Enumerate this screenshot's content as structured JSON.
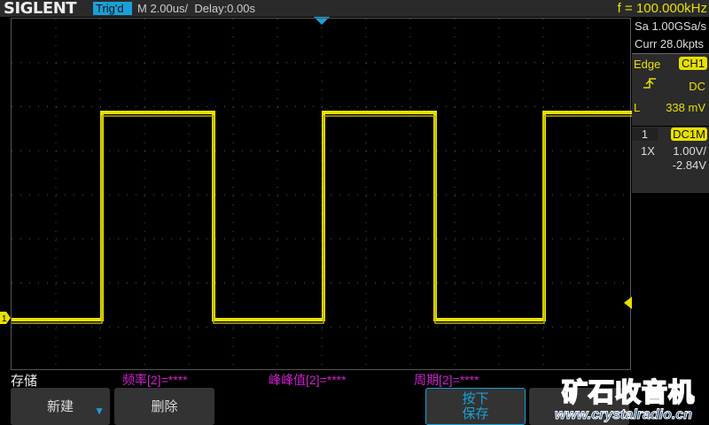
{
  "header": {
    "brand": "SIGLENT",
    "trigger_status": "Trig'd",
    "timebase": "M 2.00us/",
    "delay": "Delay:0.00s",
    "frequency": "f = 100.000kHz"
  },
  "acquisition": {
    "sample_rate": "Sa 1.00GSa/s",
    "memory": "Curr 28.0kpts"
  },
  "trigger": {
    "type": "Edge",
    "source": "CH1",
    "coupling": "DC",
    "level_label": "L",
    "level": "338 mV"
  },
  "channel": {
    "number": "1",
    "coupling": "DC1M",
    "probe": "1X",
    "scale": "1.00V/",
    "offset": "-2.84V"
  },
  "marker": {
    "ch1_label": "1"
  },
  "menu": {
    "title": "存储"
  },
  "measurements": [
    "频率[2]=****",
    "峰峰值[2]=****",
    "周期[2]=****"
  ],
  "buttons": {
    "new": "新建",
    "delete": "删除",
    "press_line1": "按下",
    "press_line2": "保存"
  },
  "watermark": {
    "name": "矿石收音机",
    "url": "www.crystalradio.cn"
  },
  "colors": {
    "ch1": "#e8e000",
    "accent": "#1aa0d8",
    "measure": "#d020d0"
  }
}
